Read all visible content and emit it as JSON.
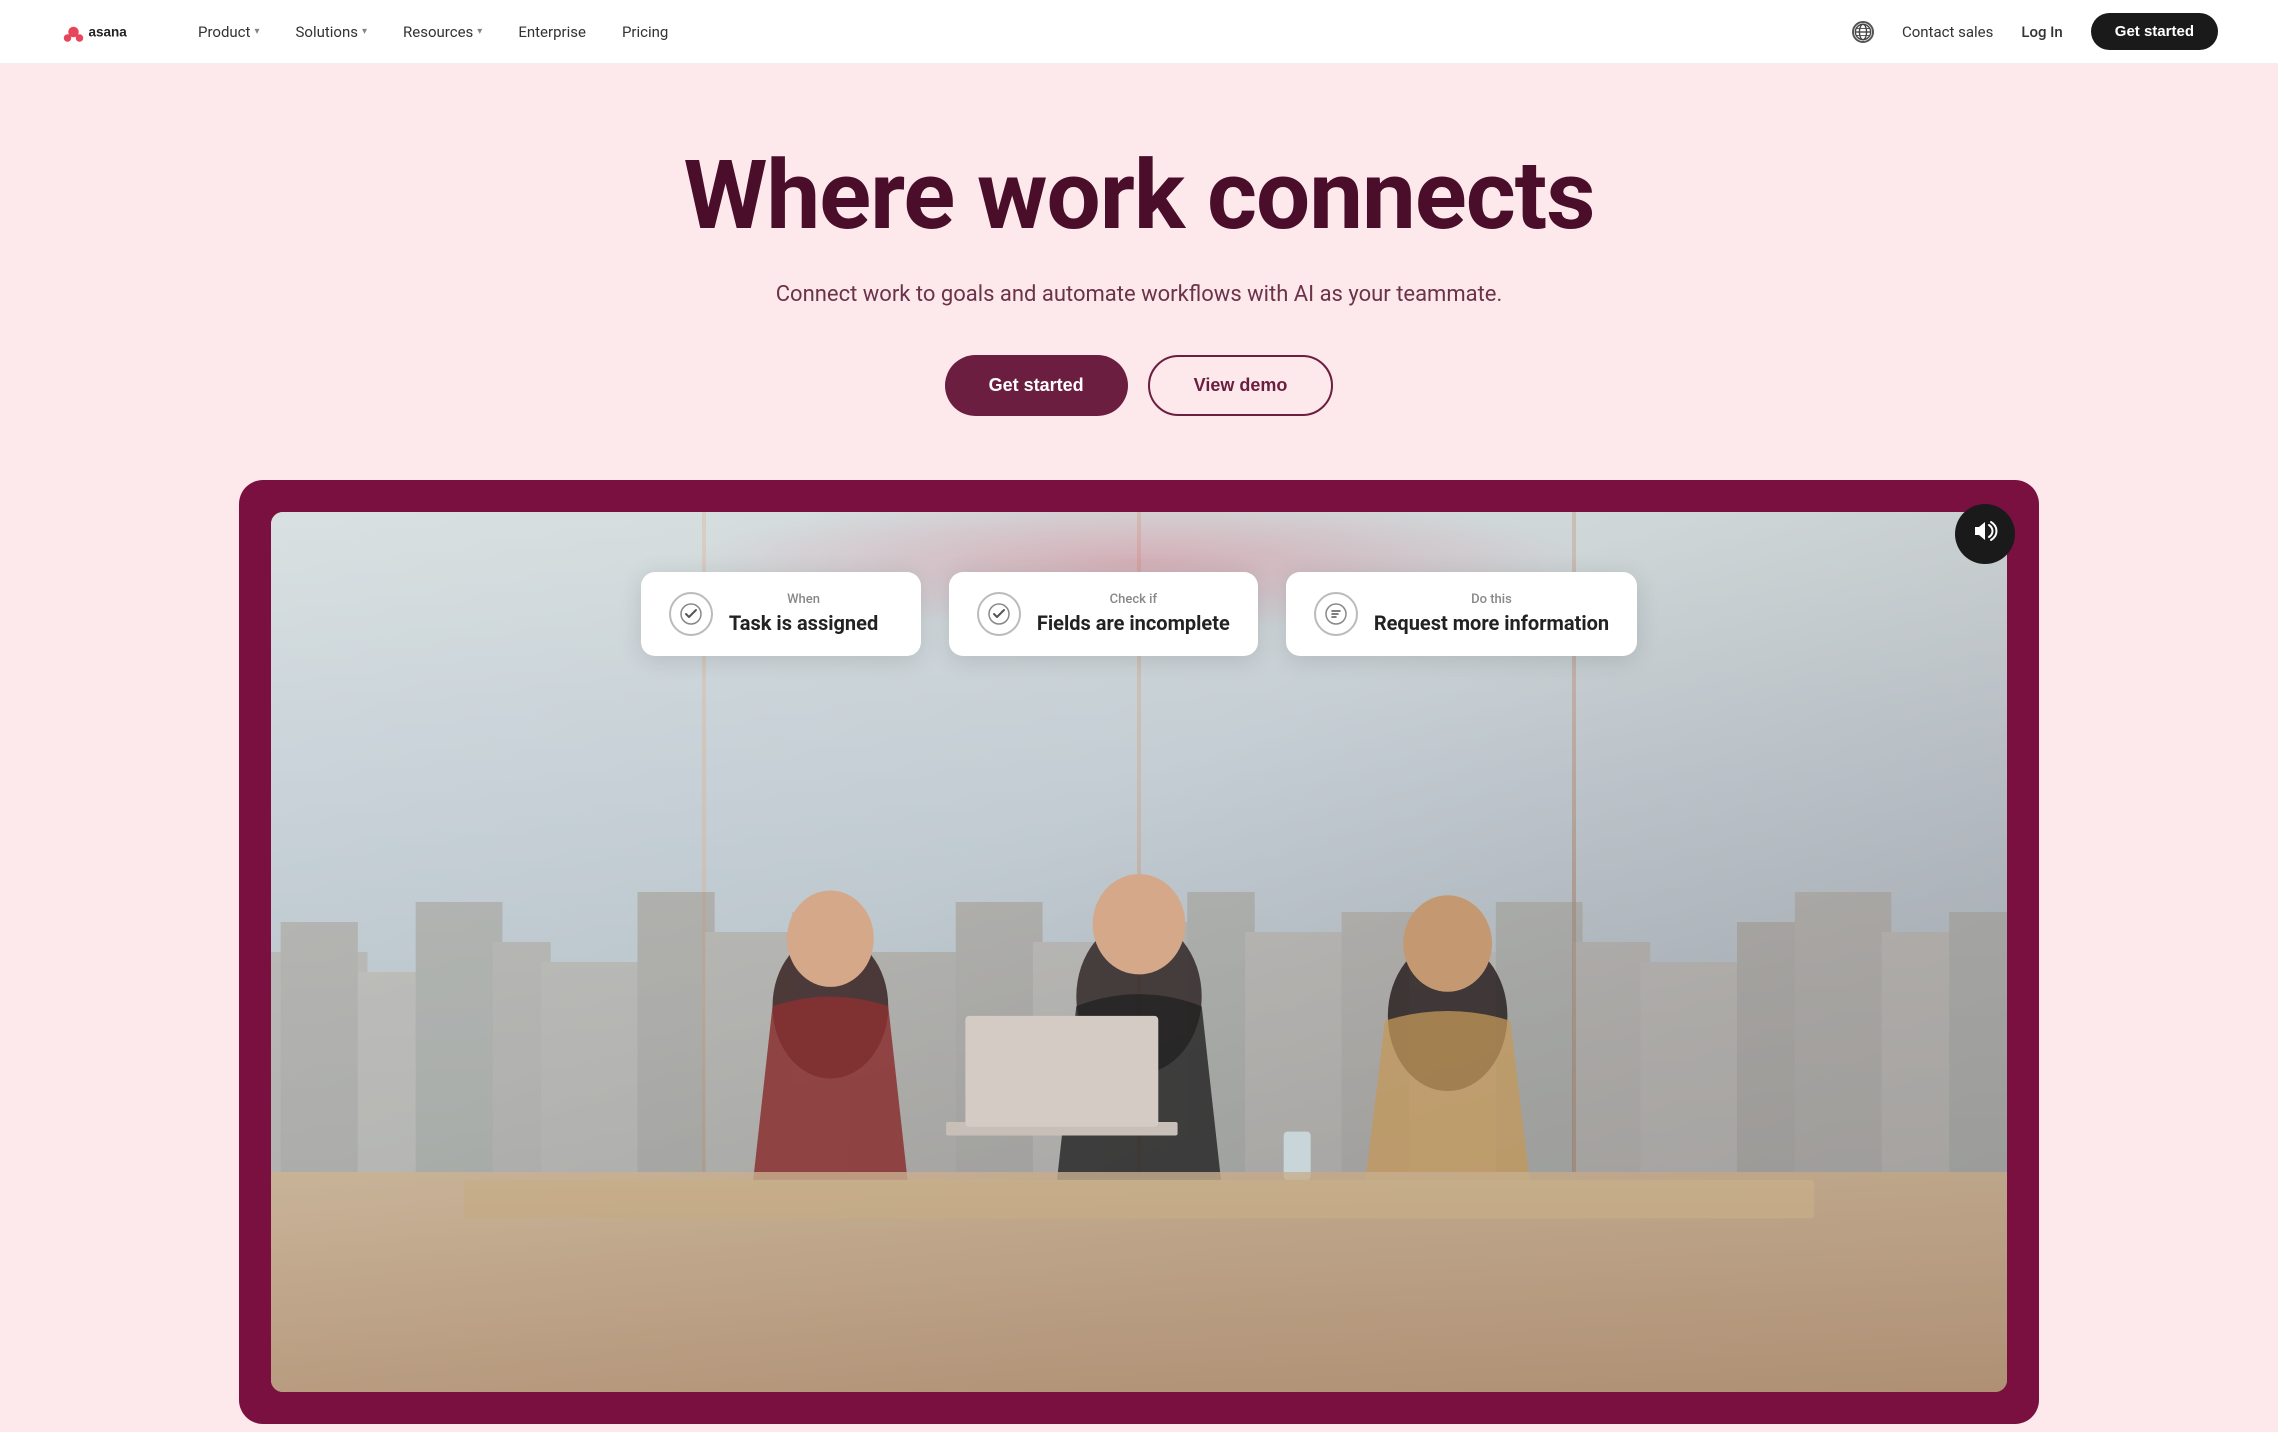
{
  "nav": {
    "logo_text": "asana",
    "links": [
      {
        "label": "Product",
        "has_dropdown": true
      },
      {
        "label": "Solutions",
        "has_dropdown": true
      },
      {
        "label": "Resources",
        "has_dropdown": true
      },
      {
        "label": "Enterprise",
        "has_dropdown": false
      },
      {
        "label": "Pricing",
        "has_dropdown": false
      }
    ],
    "contact_sales": "Contact sales",
    "login": "Log In",
    "cta": "Get started"
  },
  "hero": {
    "title": "Where work connects",
    "subtitle": "Connect work to goals and automate workflows with AI as your teammate.",
    "btn_primary": "Get started",
    "btn_secondary": "View demo"
  },
  "workflow_cards": [
    {
      "label": "When",
      "title": "Task is assigned",
      "icon_type": "check-circle"
    },
    {
      "label": "Check if",
      "title": "Fields are incomplete",
      "icon_type": "check-circle"
    },
    {
      "label": "Do this",
      "title": "Request more information",
      "icon_type": "comment-circle"
    }
  ],
  "video": {
    "sound_label": "sound-on"
  },
  "colors": {
    "brand_dark": "#6b1e40",
    "bg_hero": "#fde8ec",
    "video_bg": "#7a1040",
    "nav_cta_bg": "#1a1a1a"
  }
}
